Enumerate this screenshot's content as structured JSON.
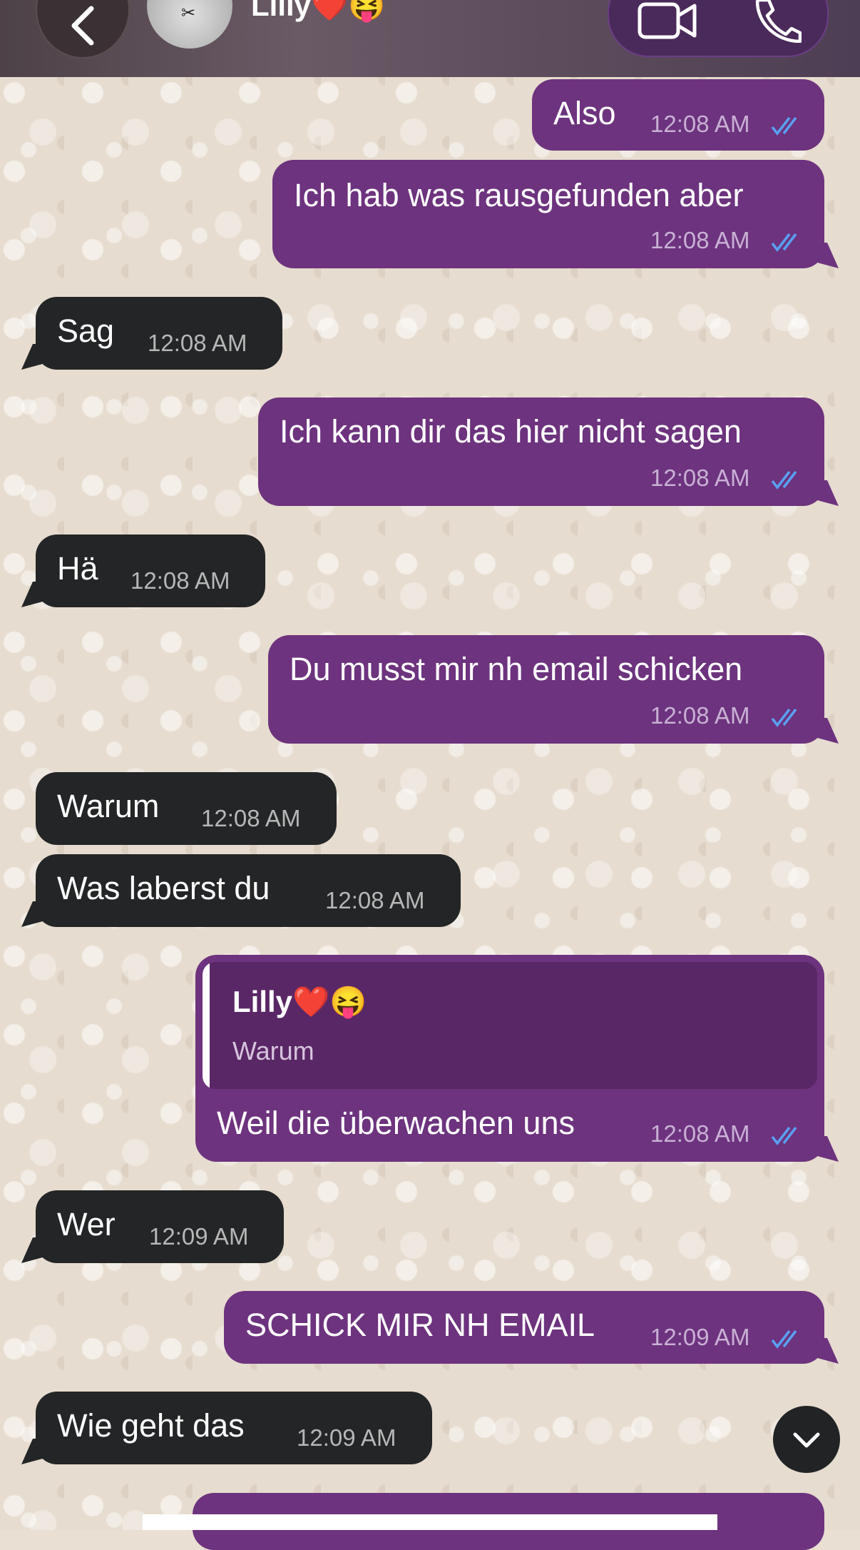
{
  "header": {
    "contact_name": "Lilly❤️😝",
    "avatar_glyph": "✂"
  },
  "messages": [
    {
      "dir": "out",
      "text": "Also",
      "time": "12:08 AM"
    },
    {
      "dir": "out",
      "text": "Ich hab was rausgefunden aber",
      "time": "12:08 AM"
    },
    {
      "dir": "in",
      "text": "Sag",
      "time": "12:08 AM"
    },
    {
      "dir": "out",
      "text": "Ich kann dir das hier nicht sagen",
      "time": "12:08 AM"
    },
    {
      "dir": "in",
      "text": "Hä",
      "time": "12:08 AM"
    },
    {
      "dir": "out",
      "text": "Du musst mir nh email schicken",
      "time": "12:08 AM"
    },
    {
      "dir": "in",
      "text": "Warum",
      "time": "12:08 AM"
    },
    {
      "dir": "in",
      "text": "Was laberst du",
      "time": "12:08 AM"
    },
    {
      "dir": "out",
      "text": "Weil die überwachen uns",
      "time": "12:08 AM",
      "reply": {
        "name": "Lilly❤️😝",
        "text": "Warum"
      }
    },
    {
      "dir": "in",
      "text": "Wer",
      "time": "12:09 AM"
    },
    {
      "dir": "out",
      "text": "SCHICK MIR NH EMAIL",
      "time": "12:09 AM"
    },
    {
      "dir": "in",
      "text": "Wie geht das",
      "time": "12:09 AM"
    }
  ],
  "colors": {
    "outgoing_bubble": "#6d337e",
    "incoming_bubble": "#232526",
    "read_ticks": "#5aa0f2"
  }
}
